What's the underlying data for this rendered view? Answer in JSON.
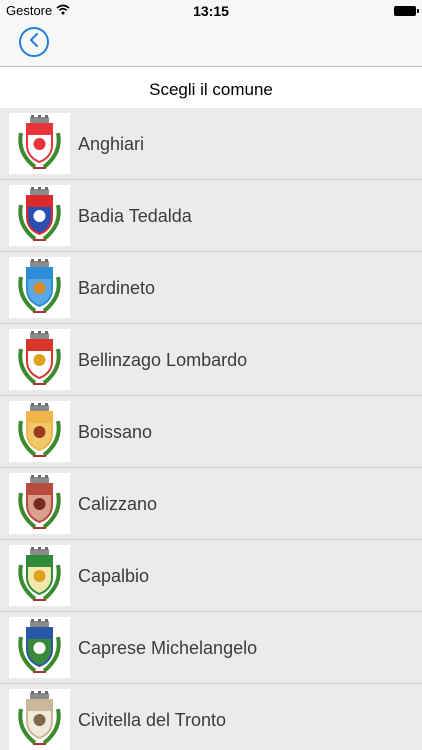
{
  "status_bar": {
    "carrier": "Gestore",
    "time": "13:15"
  },
  "nav": {
    "back_icon": "chevron-left-circle-icon"
  },
  "header": {
    "title": "Scegli il comune"
  },
  "colors": {
    "accent": "#1f7fe0",
    "list_bg": "#ebebeb",
    "separator": "#cdcdcd"
  },
  "items": [
    {
      "label": "Anghiari",
      "shield": "#e8323c",
      "field": "#ffffff",
      "emblem": "#e8323c"
    },
    {
      "label": "Badia Tedalda",
      "shield": "#d92b2b",
      "field": "#2b4fb0",
      "emblem": "#ffffff"
    },
    {
      "label": "Bardineto",
      "shield": "#2d8ed8",
      "field": "#5aa9e6",
      "emblem": "#d88a2a"
    },
    {
      "label": "Bellinzago Lombardo",
      "shield": "#d9362a",
      "field": "#ffffff",
      "emblem": "#e0a020"
    },
    {
      "label": "Boissano",
      "shield": "#f0b64a",
      "field": "#f3c86a",
      "emblem": "#9b3a1e"
    },
    {
      "label": "Calizzano",
      "shield": "#b84a3e",
      "field": "#d9a090",
      "emblem": "#7b2a22"
    },
    {
      "label": "Capalbio",
      "shield": "#2f8b3a",
      "field": "#f2e8b0",
      "emblem": "#e0a020"
    },
    {
      "label": "Caprese Michelangelo",
      "shield": "#2a58a8",
      "field": "#3a8a3a",
      "emblem": "#ffffff"
    },
    {
      "label": "Civitella del Tronto",
      "shield": "#c9b99a",
      "field": "#f0ead8",
      "emblem": "#7b6a4a"
    }
  ]
}
